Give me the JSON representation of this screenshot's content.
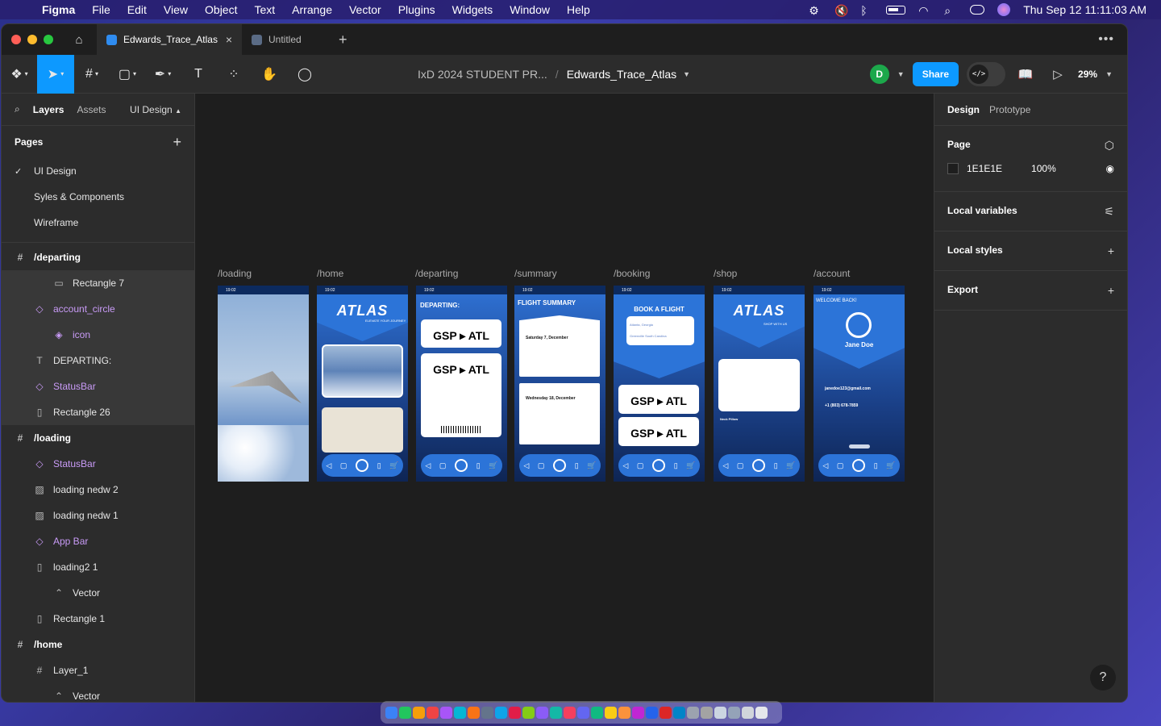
{
  "menubar": {
    "app": "Figma",
    "items": [
      "File",
      "Edit",
      "View",
      "Object",
      "Text",
      "Arrange",
      "Vector",
      "Plugins",
      "Widgets",
      "Window",
      "Help"
    ],
    "datetime": "Thu Sep 12  11:11:03 AM"
  },
  "tabs": {
    "active": "Edwards_Trace_Atlas",
    "inactive": "Untitled",
    "close": "×",
    "new": "+"
  },
  "toolbar": {
    "project": "IxD 2024 STUDENT PR...",
    "separator": "/",
    "file": "Edwards_Trace_Atlas",
    "avatar_initial": "D",
    "share_label": "Share",
    "zoom": "29%"
  },
  "left_panel": {
    "tab_layers": "Layers",
    "tab_assets": "Assets",
    "page_selector": "UI Design",
    "pages_title": "Pages",
    "pages": [
      "UI Design",
      "Syles & Components",
      "Wireframe"
    ],
    "layers": [
      {
        "name": "/departing",
        "kind": "frame"
      },
      {
        "name": "Rectangle 7",
        "kind": "child"
      },
      {
        "name": "account_circle",
        "kind": "component"
      },
      {
        "name": "icon",
        "kind": "instance"
      },
      {
        "name": "DEPARTING:",
        "kind": "text"
      },
      {
        "name": "StatusBar",
        "kind": "component"
      },
      {
        "name": "Rectangle 26",
        "kind": "rect"
      },
      {
        "name": "/loading",
        "kind": "frame"
      },
      {
        "name": "StatusBar",
        "kind": "component"
      },
      {
        "name": "loading nedw 2",
        "kind": "image"
      },
      {
        "name": "loading nedw 1",
        "kind": "image"
      },
      {
        "name": "App Bar",
        "kind": "component"
      },
      {
        "name": "loading2 1",
        "kind": "rect"
      },
      {
        "name": "Vector",
        "kind": "vector"
      },
      {
        "name": "Rectangle 1",
        "kind": "rect"
      },
      {
        "name": "/home",
        "kind": "frame"
      },
      {
        "name": "Layer_1",
        "kind": "frame-child"
      },
      {
        "name": "Vector",
        "kind": "vector"
      }
    ]
  },
  "canvas": {
    "frames": [
      "/loading",
      "/home",
      "/departing",
      "/summary",
      "/booking",
      "/shop",
      "/account"
    ],
    "status_time": "19:02",
    "departing_title": "DEPARTING:",
    "route_from": "GSP",
    "route_to": "ATL",
    "summary_title": "FLIGHT SUMMARY",
    "summary_date1": "Saturday 7, December",
    "summary_date2": "Wednesday 18, December",
    "booking_title": "BOOK A FLIGHT",
    "booking_from": "Atlanta, Georgia",
    "booking_to": "Greenville South Carolina",
    "atlas_logo": "ATLAS",
    "atlas_tagline": "ELEVATE YOUR JOURNEY",
    "shop_tagline": "SHOP WITH US",
    "shop_item": "Neck Pillow",
    "account_welcome": "WELCOME BACK!",
    "account_name": "Jane Doe",
    "account_email": "janedoe123@gmail.com",
    "account_phone": "+1 (803) 678-7859"
  },
  "right_panel": {
    "tab_design": "Design",
    "tab_prototype": "Prototype",
    "page_title": "Page",
    "page_fill_hex": "1E1E1E",
    "page_fill_opacity": "100%",
    "local_variables": "Local variables",
    "local_styles": "Local styles",
    "export": "Export",
    "help": "?"
  },
  "colors": {
    "accent": "#0d99ff",
    "canvas_bg": "#1e1e1e",
    "component": "#c99bf7",
    "atlas_blue": "#2c74d8"
  }
}
